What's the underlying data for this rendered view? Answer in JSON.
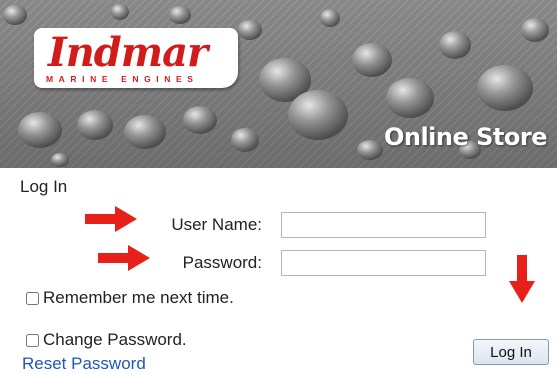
{
  "banner": {
    "brand_name": "Indmar",
    "brand_subtitle": "MARINE ENGINES",
    "store_label": "Online Store"
  },
  "form": {
    "section_title": "Log In",
    "username_label": "User Name:",
    "username_value": "",
    "password_label": "Password:",
    "password_value": "",
    "remember_label": "Remember me next time.",
    "remember_checked": false,
    "change_password_label": "Change Password.",
    "change_password_checked": false,
    "reset_link_label": "Reset Password",
    "submit_label": "Log In"
  },
  "annotations": {
    "arrow_color": "#e8201a",
    "arrow_icons": [
      "arrow-right-icon",
      "arrow-right-icon",
      "arrow-down-icon"
    ]
  },
  "colors": {
    "brand_red": "#d21c1c",
    "link_blue": "#1f56b8",
    "banner_gray": "#8c8c8c"
  }
}
